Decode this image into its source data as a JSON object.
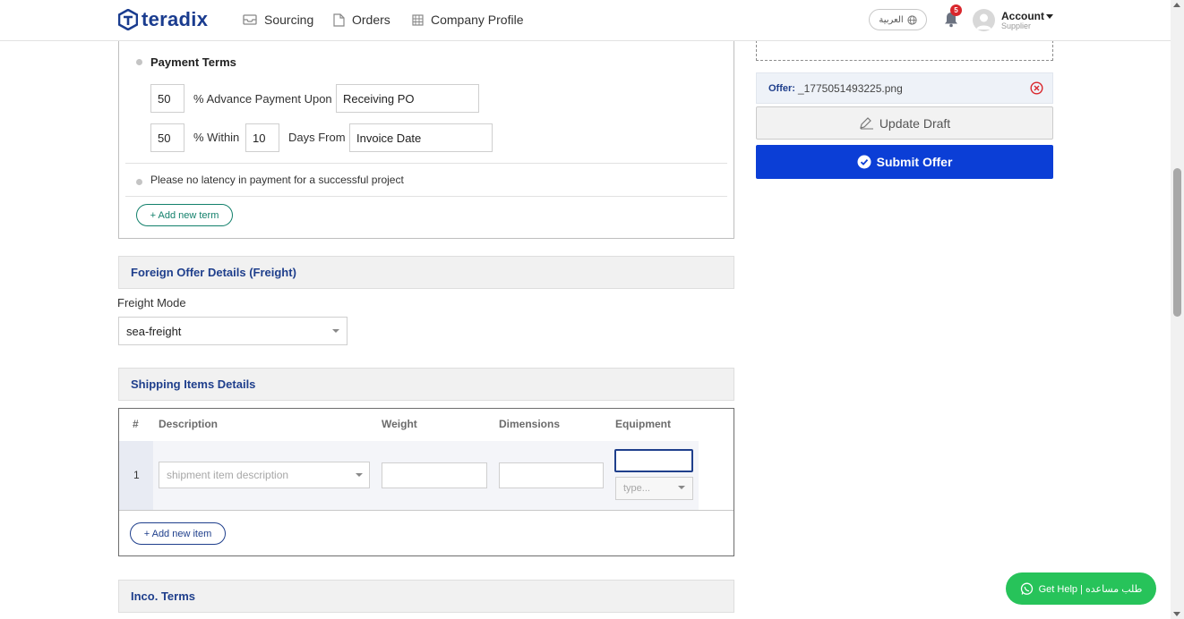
{
  "header": {
    "logo_text": "teradix",
    "nav": [
      {
        "label": "Sourcing",
        "icon": "inbox-icon"
      },
      {
        "label": "Orders",
        "icon": "document-icon"
      },
      {
        "label": "Company Profile",
        "icon": "building-icon"
      }
    ],
    "language_label": "العربية",
    "notifications_count": "5",
    "account_label": "Account",
    "account_role": "Supplier"
  },
  "payment_terms": {
    "title": "Payment Terms",
    "advance": {
      "percent": "50",
      "label": "% Advance Payment Upon",
      "trigger": "Receiving PO"
    },
    "balance": {
      "percent": "50",
      "within_label": "% Within",
      "days": "10",
      "days_from_label": "Days From",
      "reference": "Invoice Date"
    },
    "note": "Please no latency in payment for a successful project",
    "add_term_label": "+ Add new term"
  },
  "freight": {
    "section_title": "Foreign Offer Details (Freight)",
    "mode_label": "Freight Mode",
    "mode_value": "sea-freight"
  },
  "shipping": {
    "section_title": "Shipping Items Details",
    "columns": [
      "#",
      "Description",
      "Weight",
      "Dimensions",
      "Equipment"
    ],
    "rows": [
      {
        "num": "1",
        "description_placeholder": "shipment item description",
        "weight": "",
        "dimensions": "",
        "equipment": "",
        "equipment_type_placeholder": "type..."
      }
    ],
    "add_item_label": "+ Add new item"
  },
  "inco_terms": {
    "section_title": "Inco. Terms"
  },
  "sidebar": {
    "offer_label": "Offer:",
    "offer_file": "_1775051493225.png",
    "update_draft_label": "Update Draft",
    "submit_label": "Submit Offer"
  },
  "help": {
    "label": "Get Help | طلب مساعده"
  },
  "colors": {
    "primary": "#0b3ed6",
    "brand": "#1a3c8f",
    "section_text": "#1f3f8c",
    "green": "#12806b",
    "whatsapp": "#27c35a",
    "badge": "#d9262c"
  }
}
